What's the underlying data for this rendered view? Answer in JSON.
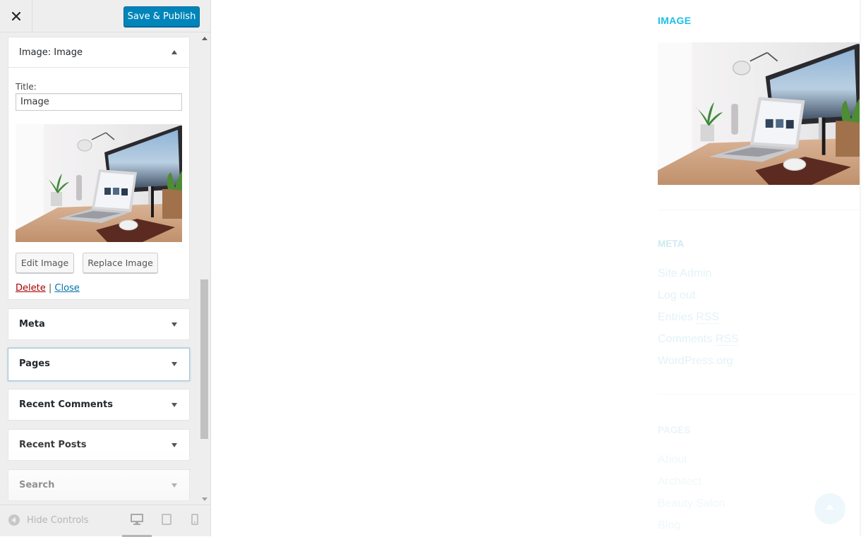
{
  "header": {
    "close_label": "Close",
    "publish_label": "Save & Publish"
  },
  "image_widget": {
    "type_label": "Image:",
    "title_suffix": "Image",
    "title_field_label": "Title:",
    "title_value": "Image",
    "edit_label": "Edit Image",
    "replace_label": "Replace Image",
    "delete_label": "Delete",
    "separator": "|",
    "close_label": "Close"
  },
  "widgets": {
    "meta": "Meta",
    "pages": "Pages",
    "recent_comments": "Recent Comments",
    "recent_posts": "Recent Posts",
    "search": "Search"
  },
  "footer": {
    "hide_controls": "Hide Controls",
    "devices": [
      "desktop-icon",
      "tablet-icon",
      "mobile-icon"
    ]
  },
  "preview": {
    "image_title": "IMAGE",
    "meta_title": "META",
    "meta_links": {
      "site_admin": "Site Admin",
      "log_out": "Log out",
      "entries": "Entries",
      "comments": "Comments",
      "rss": "RSS",
      "wordpress": "WordPress.org"
    },
    "pages_title": "PAGES",
    "pages": [
      "About",
      "Architect",
      "Beauty Salon",
      "Blog"
    ]
  },
  "colors": {
    "primary_button": "#0085ba",
    "accent": "#1ec1e6",
    "delete": "#aa0000",
    "link": "#0073aa"
  }
}
